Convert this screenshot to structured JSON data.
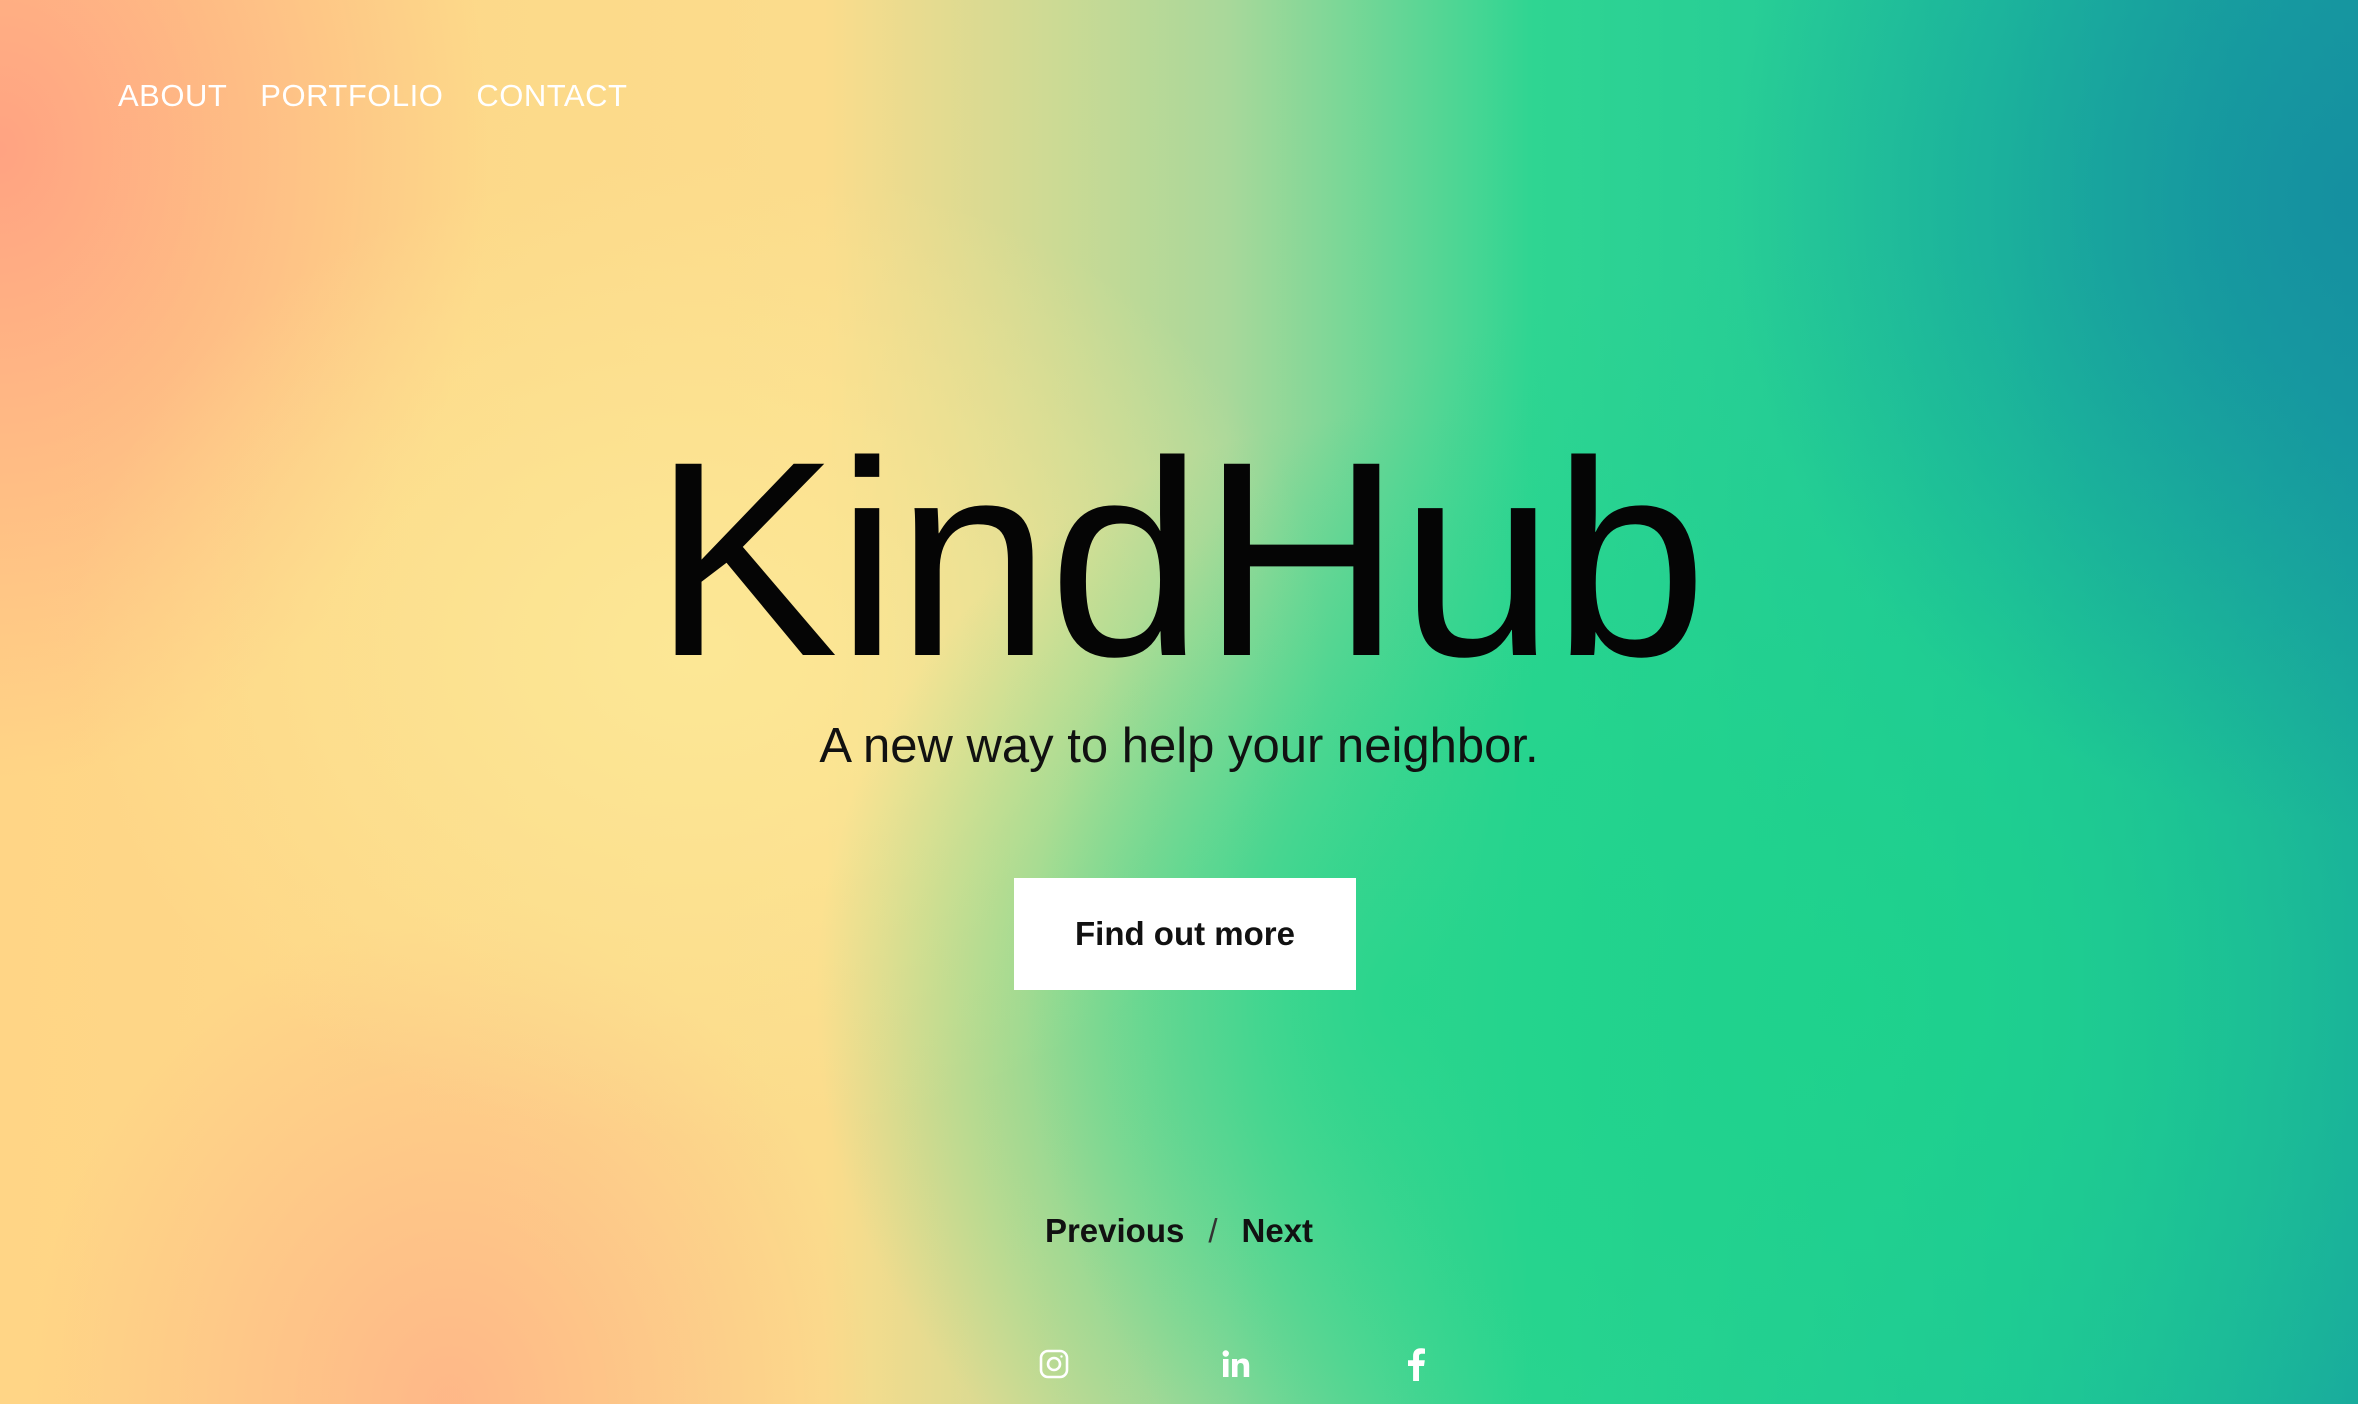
{
  "nav": {
    "items": [
      {
        "label": "ABOUT"
      },
      {
        "label": "PORTFOLIO"
      },
      {
        "label": "CONTACT"
      }
    ]
  },
  "hero": {
    "title": "KindHub",
    "subtitle": "A new way to help your neighbor.",
    "cta_label": "Find out more"
  },
  "pager": {
    "previous_label": "Previous",
    "separator": "/",
    "next_label": "Next"
  },
  "social": {
    "icons": [
      "instagram-icon",
      "linkedin-icon",
      "facebook-icon"
    ]
  },
  "colors": {
    "nav_text": "#ffffff",
    "title_text": "#050505",
    "button_bg": "#ffffff",
    "gradient_left": "#ffd586",
    "gradient_mid": "#2fd592",
    "gradient_right": "#18a3a0"
  }
}
